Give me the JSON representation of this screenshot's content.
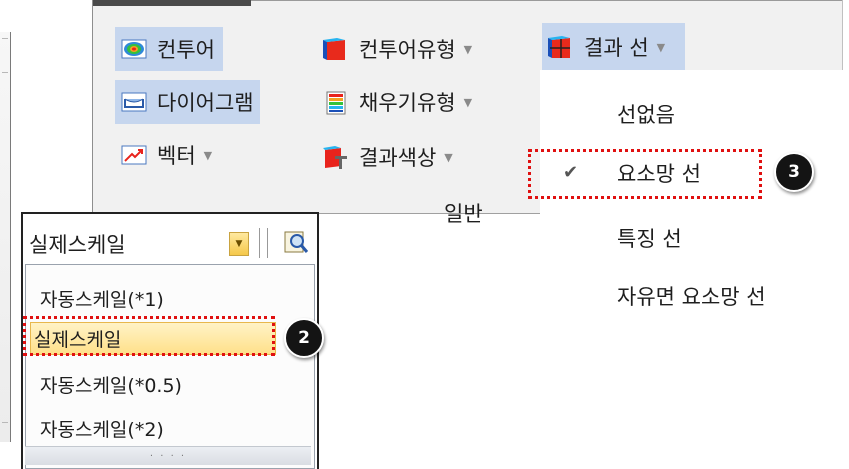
{
  "ribbon": {
    "buttons": {
      "contour": "컨투어",
      "contour_type": "컨투어유형",
      "result_line": "결과 선",
      "diagram": "다이어그램",
      "fill_type": "채우기유형",
      "vector": "벡터",
      "result_color": "결과색상"
    },
    "group_label": "일반"
  },
  "result_line_menu": {
    "items": [
      "선없음",
      "요소망 선",
      "특징 선",
      "자유면 요소망 선"
    ],
    "checked_index": 1
  },
  "scale_combo": {
    "value": "실제스케일",
    "options": [
      "자동스케일(*1)",
      "실제스케일",
      "자동스케일(*0.5)",
      "자동스케일(*2)"
    ],
    "selected_index": 1
  },
  "callouts": {
    "badge_2": "2",
    "badge_3": "3"
  },
  "colors": {
    "highlight_blue": "#c6d6ee",
    "callout_red": "#e01010",
    "selection_yellow": "#ffe08a"
  }
}
